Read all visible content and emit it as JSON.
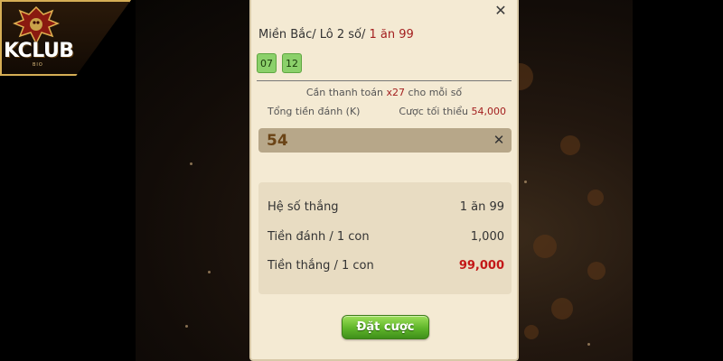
{
  "logo": {
    "text": "KCLUB",
    "sub": "BIO"
  },
  "dialog": {
    "title_prefix": "Miền Bắc/ Lô 2 số/ ",
    "title_odds": "1 ăn 99",
    "chips": [
      "07",
      "12"
    ],
    "pay_prefix": "Cần thanh toán ",
    "pay_multiplier": "x27",
    "pay_suffix": " cho mỗi số",
    "total_label": "Tổng tiền đánh (K)",
    "min_bet_label": "Cược tối thiểu ",
    "min_bet_value": "54,000",
    "amount_value": "54",
    "summary": {
      "win_rate_label": "Hệ số thắng",
      "win_rate_value": "1 ăn 99",
      "stake_label": "Tiền đánh / 1 con",
      "stake_value": "1,000",
      "payout_label": "Tiền thắng / 1 con",
      "payout_value": "99,000"
    },
    "bet_button": "Đặt cược"
  },
  "colors": {
    "accent_red": "#a31e1e",
    "chip_green": "#8bd06a",
    "button_green": "#5fb52a",
    "panel_bg": "#f4ead3"
  },
  "icons": {
    "close": "close-icon",
    "clear": "clear-icon",
    "logo": "dragon-logo-icon"
  }
}
